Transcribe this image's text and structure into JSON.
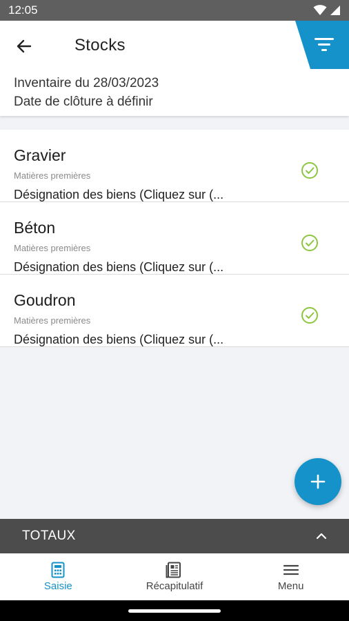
{
  "status_bar": {
    "time": "12:05"
  },
  "header": {
    "title": "Stocks",
    "inventory_line": "Inventaire du 28/03/2023",
    "closing_line": "Date de clôture à définir"
  },
  "items": [
    {
      "name": "Gravier",
      "category": "Matières premières",
      "designation": "Désignation des biens (Cliquez sur (..."
    },
    {
      "name": "Béton",
      "category": "Matières premières",
      "designation": "Désignation des biens (Cliquez sur (..."
    },
    {
      "name": "Goudron",
      "category": "Matières premières",
      "designation": "Désignation des biens (Cliquez sur (..."
    }
  ],
  "totals": {
    "label": "TOTAUX"
  },
  "nav": [
    {
      "label": "Saisie",
      "icon": "calculator-icon",
      "active": true
    },
    {
      "label": "Récapitulatif",
      "icon": "document-icon",
      "active": false
    },
    {
      "label": "Menu",
      "icon": "hamburger-icon",
      "active": false
    }
  ],
  "colors": {
    "accent": "#1592c9",
    "check_green": "#8cc63f",
    "totals_bar": "#4c4c4c",
    "status_bar": "#5f5f5f"
  }
}
